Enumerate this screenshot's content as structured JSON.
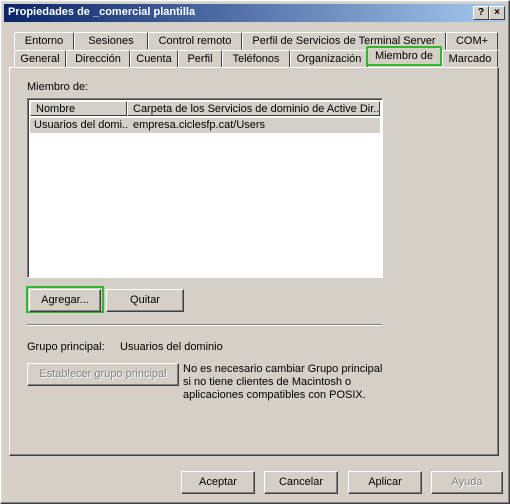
{
  "window": {
    "title": "Propiedades de _comercial plantilla",
    "help_glyph": "?",
    "close_glyph": "×"
  },
  "tabs_row1": [
    "Entorno",
    "Sesiones",
    "Control remoto",
    "Perfil de Servicios de Terminal Server",
    "COM+"
  ],
  "tabs_row2": [
    "General",
    "Dirección",
    "Cuenta",
    "Perfil",
    "Teléfonos",
    "Organización",
    "Miembro de",
    "Marcado"
  ],
  "active_tab": "Miembro de",
  "member_of": {
    "label": "Miembro de:",
    "columns": [
      "Nombre",
      "Carpeta de los Servicios de dominio de Active Dir..."
    ],
    "rows": [
      {
        "name": "Usuarios del domi...",
        "folder": "empresa.ciclesfp.cat/Users"
      }
    ]
  },
  "buttons": {
    "add": "Agregar...",
    "remove": "Quitar",
    "set_primary": "Establecer grupo principal",
    "ok": "Aceptar",
    "cancel": "Cancelar",
    "apply": "Aplicar",
    "help": "Ayuda"
  },
  "primary_group": {
    "label": "Grupo principal:",
    "value": "Usuarios del dominio",
    "note_lines": [
      "No es necesario cambiar Grupo principal",
      "si no tiene clientes de Macintosh o",
      "aplicaciones compatibles con POSIX."
    ]
  },
  "colors": {
    "highlight": "#2db82d",
    "title_start": "#0a246a",
    "title_end": "#a6caf0",
    "face": "#d4d0c8"
  }
}
